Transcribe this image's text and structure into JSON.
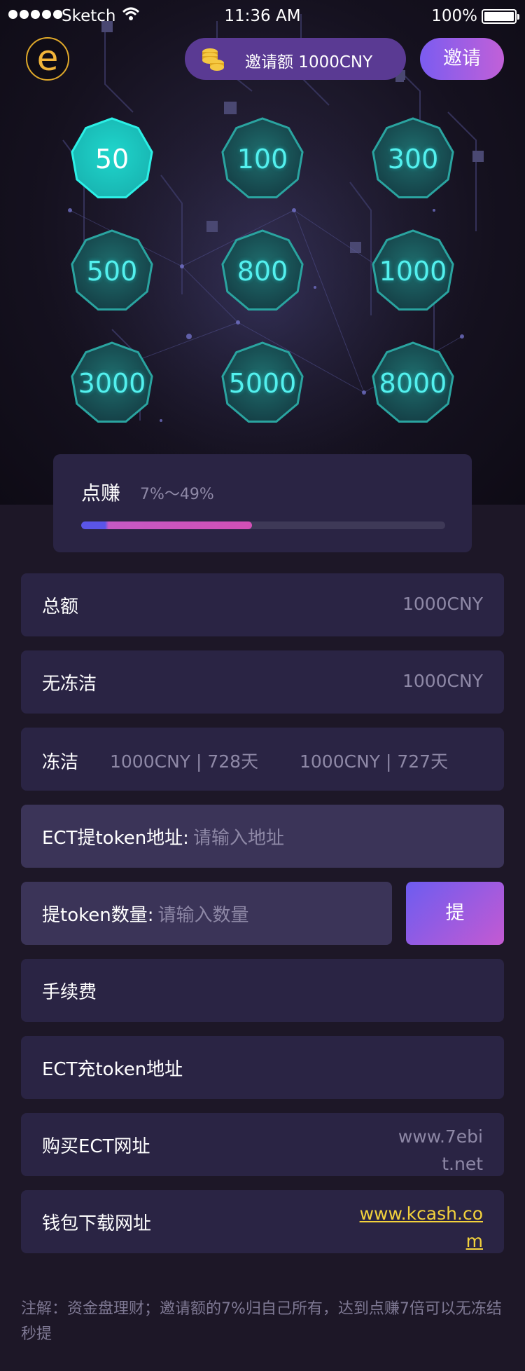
{
  "status_bar": {
    "carrier": "Sketch",
    "time": "11:36 AM",
    "battery": "100%"
  },
  "header": {
    "logo_letter": "e",
    "invite_amount": "邀请额 1000CNY",
    "invite_button": "邀请"
  },
  "amounts": [
    {
      "value": "50",
      "selected": true
    },
    {
      "value": "100",
      "selected": false
    },
    {
      "value": "300",
      "selected": false
    },
    {
      "value": "500",
      "selected": false
    },
    {
      "value": "800",
      "selected": false
    },
    {
      "value": "1000",
      "selected": false
    },
    {
      "value": "3000",
      "selected": false
    },
    {
      "value": "5000",
      "selected": false
    },
    {
      "value": "8000",
      "selected": false
    }
  ],
  "rate": {
    "label": "点赚",
    "range": "7%～49%",
    "progress_fraction": 0.47
  },
  "rows": {
    "total": {
      "label": "总额",
      "value": "1000CNY"
    },
    "unfrozen": {
      "label": "无冻洁",
      "value": "1000CNY"
    },
    "frozen": {
      "label": "冻洁",
      "items": [
        "1000CNY | 728天",
        "1000CNY | 727天"
      ]
    },
    "ect_address": {
      "label": "ECT提token地址:",
      "placeholder": "请输入地址"
    },
    "token_amount": {
      "label": "提token数量:",
      "placeholder": "请输入数量"
    },
    "fee": {
      "label": "手续费"
    },
    "ect_deposit": {
      "label": "ECT充token地址"
    },
    "buy_url": {
      "label": "购买ECT网址",
      "value": "www.7ebit.net"
    },
    "wallet_url": {
      "label": "钱包下载网址",
      "value": "www.kcash.com"
    }
  },
  "withdraw_button": "提",
  "note": "注解：资金盘理财；邀请额的7%归自己所有，达到点赚7倍可以无冻结秒提",
  "colors": {
    "accent_cyan": "#53f0ee",
    "link": "#f3d23c",
    "card": "#2a2444",
    "gradient_start": "#6d5cf0",
    "gradient_end": "#c45ad2"
  }
}
